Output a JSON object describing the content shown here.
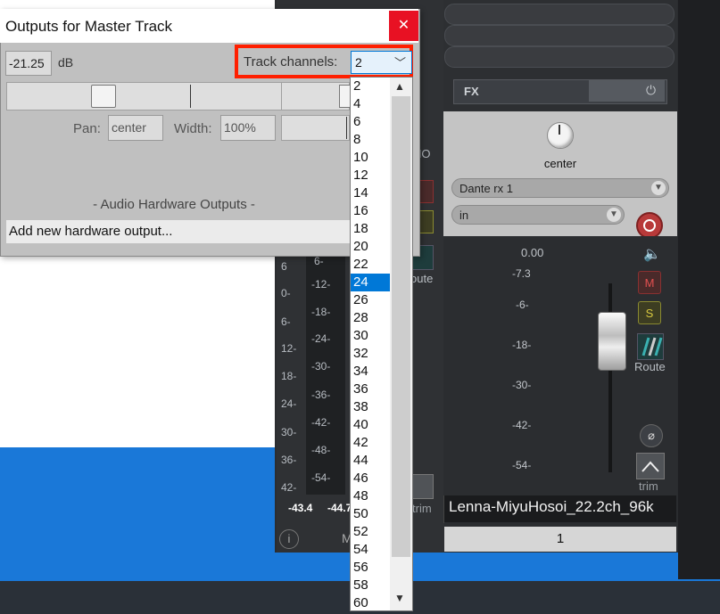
{
  "dialog": {
    "title": "Outputs for Master Track",
    "close_glyph": "✕",
    "volume_value": "-21.25",
    "volume_unit": "dB",
    "track_channels_label": "Track channels:",
    "track_channels_value": "2",
    "pan_label": "Pan:",
    "pan_value": "center",
    "width_label": "Width:",
    "width_value": "100%",
    "hardware_section_label": "-  Audio Hardware Outputs  -",
    "add_hardware_output": "Add new hardware output..."
  },
  "channel_options": [
    "2",
    "4",
    "6",
    "8",
    "10",
    "12",
    "14",
    "16",
    "18",
    "20",
    "22",
    "24",
    "26",
    "28",
    "30",
    "32",
    "34",
    "36",
    "38",
    "40",
    "42",
    "44",
    "46",
    "48",
    "50",
    "52",
    "54",
    "56",
    "58",
    "60"
  ],
  "channel_selected": "24",
  "mixer_left": {
    "meter_scale": [
      "6",
      "0-",
      "6-",
      "12-",
      "18-",
      "24-",
      "30-",
      "36-",
      "42-"
    ],
    "meter_scale2": [
      "6-",
      "-12-",
      "-18-",
      "-24-",
      "-30-",
      "-36-",
      "-42-",
      "-48-",
      "-54-"
    ],
    "peak_left": "-43.4",
    "peak_right": "-44.7",
    "partial_no": "NO",
    "partial_route": "oute",
    "partial_trim": "trim",
    "info_glyph": "i",
    "m_label": "M"
  },
  "strip": {
    "fx_label": "FX",
    "pan_value": "center",
    "input_device": "Dante rx 1",
    "input_mode": "in",
    "volume_value": "0.00",
    "scale": [
      "-7.3",
      "-6-",
      "-18-",
      "-30-",
      "-42-",
      "-54-"
    ],
    "mute_label": "M",
    "solo_label": "S",
    "route_label": "Route",
    "phase_glyph": "⌀",
    "trim_label": "trim",
    "track_name": "Lenna-MiyuHosoi_22.2ch_96k",
    "track_number": "1"
  },
  "colors": {
    "highlight": "#ff1f00",
    "selection": "#0078d7",
    "close": "#e81123"
  }
}
